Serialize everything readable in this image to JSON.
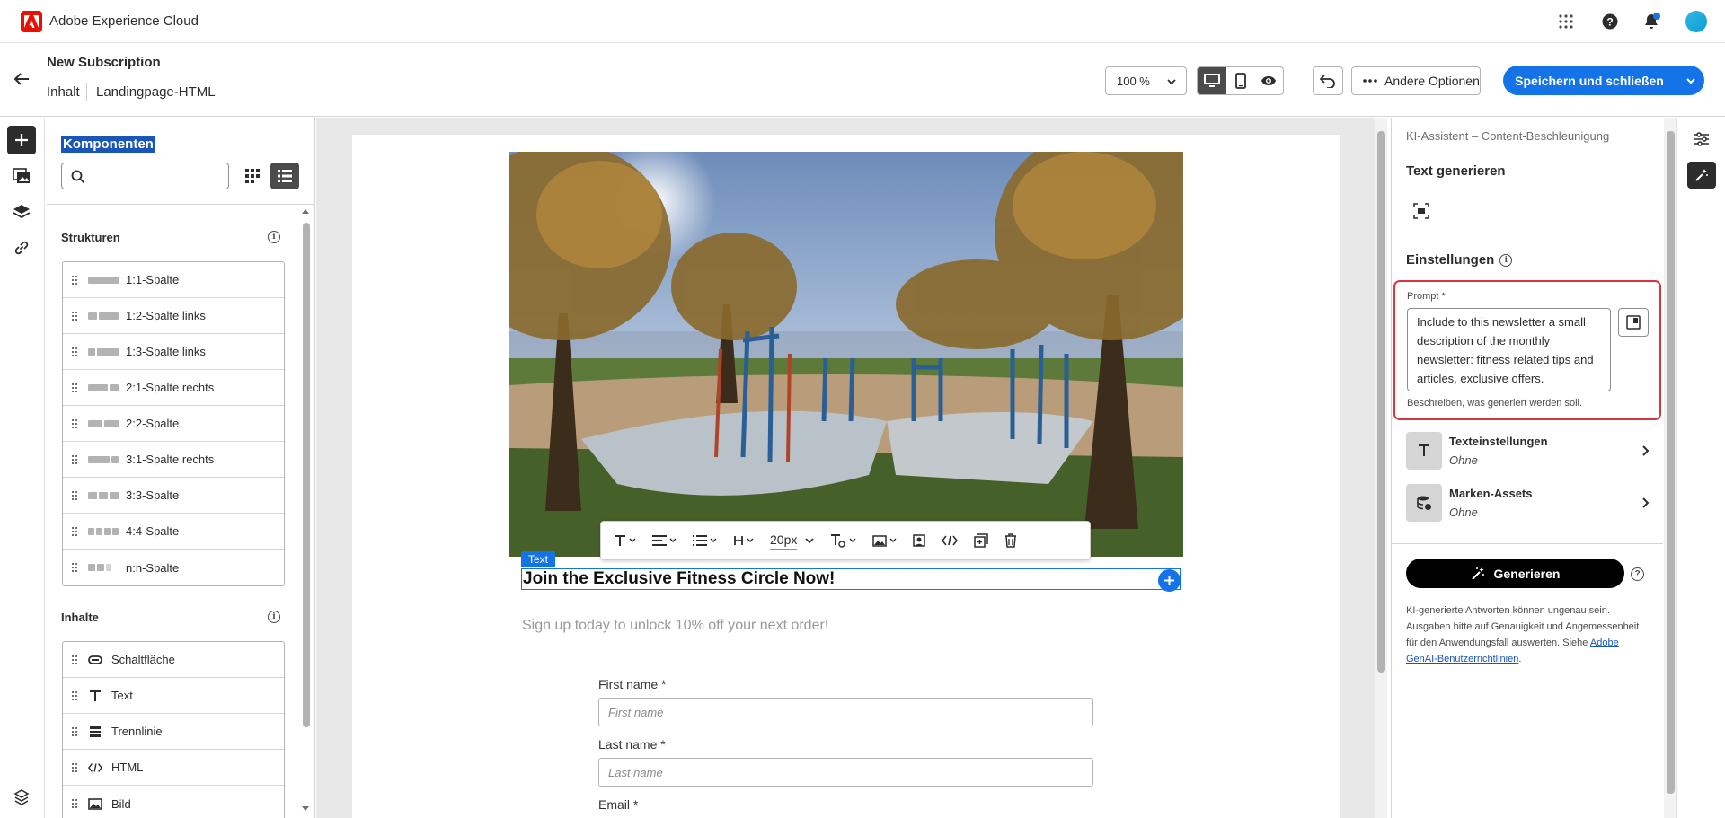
{
  "app": {
    "brand": "Adobe Experience Cloud"
  },
  "header": {
    "title": "New Subscription",
    "breadcrumb": [
      "Inhalt",
      "Landingpage-HTML"
    ],
    "zoom": "100 %",
    "more_options": "Andere Optionen",
    "save": "Speichern und schließen"
  },
  "components_panel": {
    "title": "Komponenten",
    "search_placeholder": "",
    "structures_heading": "Strukturen",
    "structures": [
      "1:1-Spalte",
      "1:2-Spalte links",
      "1:3-Spalte links",
      "2:1-Spalte rechts",
      "2:2-Spalte",
      "3:1-Spalte rechts",
      "3:3-Spalte",
      "4:4-Spalte",
      "n:n-Spalte"
    ],
    "contents_heading": "Inhalte",
    "contents": [
      "Schaltfläche",
      "Text",
      "Trennlinie",
      "HTML",
      "Bild"
    ]
  },
  "canvas": {
    "toolbar_font_size": "20px",
    "selected_tag": "Text",
    "headline": "Join the Exclusive Fitness Circle Now!",
    "subtitle": "Sign up today to unlock 10% off your next order!",
    "fields": [
      {
        "label": "First name",
        "required": "*",
        "placeholder": "First name"
      },
      {
        "label": "Last name",
        "required": "*",
        "placeholder": "Last name"
      },
      {
        "label": "Email",
        "required": "*"
      }
    ]
  },
  "ai_panel": {
    "title": "KI-Assistent – Content-Beschleunigung",
    "heading": "Text generieren",
    "settings_heading": "Einstellungen",
    "prompt_label": "Prompt",
    "prompt_required": "*",
    "prompt_value": "Include to this newsletter a small description of the monthly newsletter: fitness related tips and articles, exclusive offers.",
    "prompt_help": "Beschreiben, was generiert werden soll.",
    "text_settings": {
      "name": "Texteinstellungen",
      "value": "Ohne"
    },
    "brand_assets": {
      "name": "Marken-Assets",
      "value": "Ohne"
    },
    "generate": "Generieren",
    "disclaimer": "KI-generierte Antworten können ungenau sein. Ausgaben bitte auf Genauigkeit und Angemessenheit für den Anwendungsfall auswerten. Siehe ",
    "disclaimer_link": "Adobe GenAI-Benutzerrichtlinien",
    "disclaimer_end": "."
  },
  "colors": {
    "accent": "#1473e6",
    "highlight_border": "#d7373f",
    "brand_red": "#eb1000"
  }
}
